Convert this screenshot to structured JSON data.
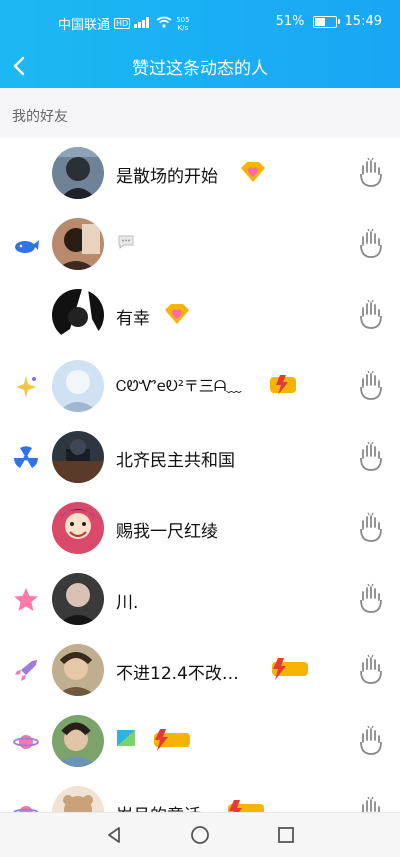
{
  "status_bar": {
    "carrier": "中国联通",
    "hd_label": "HD",
    "net_speed_value": "505",
    "net_speed_unit": "K/s",
    "battery": "51%",
    "time": "15:49",
    "battery_level": 0.51
  },
  "header": {
    "title": "赞过这条动态的人"
  },
  "section": {
    "label": "我的好友"
  },
  "friends": [
    {
      "name": "是散场的开始",
      "badge": "none",
      "vip": "diamond-heart"
    },
    {
      "name": "",
      "badge": "whale-icon",
      "vip": "chat-bubble"
    },
    {
      "name": "有幸",
      "badge": "none",
      "vip": "diamond-heart"
    },
    {
      "name": "ᏟᏬᏉeᎧ²〒三ᗩ﹏",
      "badge": "sparkle-icon",
      "vip": "lightning-badge"
    },
    {
      "name": "北齐民主共和国",
      "badge": "radiation-icon",
      "vip": "none"
    },
    {
      "name": "赐我一尺红绫",
      "badge": "none",
      "vip": "none"
    },
    {
      "name": "川.",
      "badge": "pink-star-icon",
      "vip": "none"
    },
    {
      "name": "不进12.4不改…",
      "badge": "rocket-icon",
      "vip": "lightning-badge"
    },
    {
      "name": "",
      "badge": "planet-icon",
      "vip": "lightning-badge"
    },
    {
      "name": "岁月的童话",
      "badge": "planet-icon",
      "vip": "lightning-badge"
    }
  ],
  "colors": {
    "header_blue": "#19a6f4",
    "accent_gold": "#f5b400",
    "pink_heart": "#ff6aa8"
  }
}
